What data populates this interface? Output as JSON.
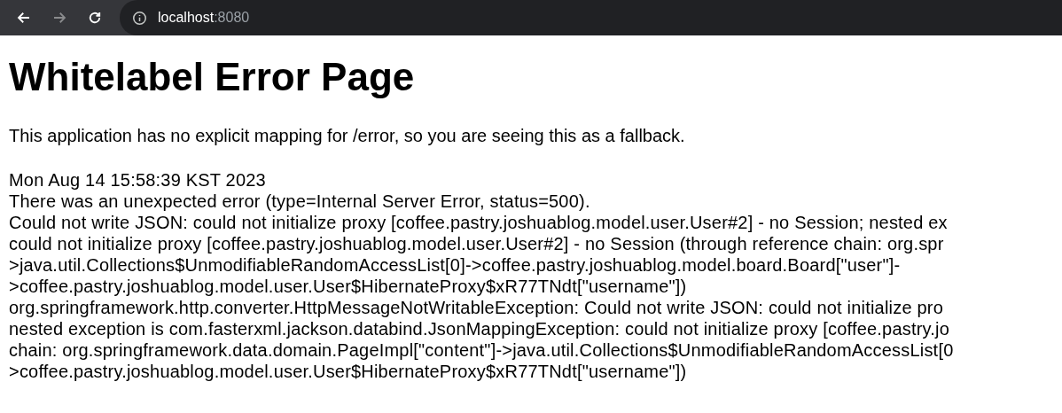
{
  "browser": {
    "address_host": "localhost",
    "address_port": ":8080"
  },
  "page": {
    "title": "Whitelabel Error Page",
    "intro": "This application has no explicit mapping for /error, so you are seeing this as a fallback.",
    "lines": [
      "Mon Aug 14 15:58:39 KST 2023",
      "There was an unexpected error (type=Internal Server Error, status=500).",
      "Could not write JSON: could not initialize proxy [coffee.pastry.joshuablog.model.user.User#2] - no Session; nested ex",
      "could not initialize proxy [coffee.pastry.joshuablog.model.user.User#2] - no Session (through reference chain: org.spr",
      ">java.util.Collections$UnmodifiableRandomAccessList[0]->coffee.pastry.joshuablog.model.board.Board[\"user\"]-",
      ">coffee.pastry.joshuablog.model.user.User$HibernateProxy$xR77TNdt[\"username\"])",
      "org.springframework.http.converter.HttpMessageNotWritableException: Could not write JSON: could not initialize pro",
      "nested exception is com.fasterxml.jackson.databind.JsonMappingException: could not initialize proxy [coffee.pastry.jo",
      "chain: org.springframework.data.domain.PageImpl[\"content\"]->java.util.Collections$UnmodifiableRandomAccessList[0",
      ">coffee.pastry.joshuablog.model.user.User$HibernateProxy$xR77TNdt[\"username\"])"
    ]
  }
}
